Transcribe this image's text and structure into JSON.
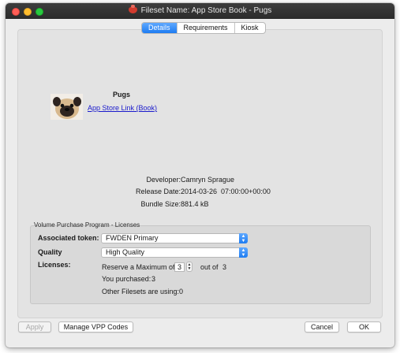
{
  "window": {
    "title": "Fileset Name: App Store Book - Pugs"
  },
  "tabs": [
    {
      "label": "Details",
      "active": true
    },
    {
      "label": "Requirements",
      "active": false
    },
    {
      "label": "Kiosk",
      "active": false
    }
  ],
  "app": {
    "name": "Pugs",
    "link_text": "App Store Link (Book)"
  },
  "info": {
    "developer_label": "Developer:",
    "developer_value": "Camryn Sprague",
    "release_label": "Release Date:",
    "release_value": "2014-03-26  07:00:00+00:00",
    "size_label": "Bundle Size:",
    "size_value": "881.4 kB"
  },
  "vpp": {
    "section_title": "Volume Purchase Program - Licenses",
    "token_label": "Associated token:",
    "token_value": "FWDEN Primary",
    "quality_label": "Quality",
    "quality_value": "High Quality",
    "licenses_label": "Licenses:",
    "reserve_prefix": "Reserve a Maximum of",
    "reserve_value": "3",
    "reserve_suffix": "out of",
    "reserve_total": "3",
    "purchased_text": "You purchased:",
    "purchased_value": "3",
    "other_text": "Other Filesets are using:",
    "other_value": "0"
  },
  "buttons": {
    "apply": "Apply",
    "manage_vpp": "Manage VPP Codes",
    "cancel": "Cancel",
    "ok": "OK"
  },
  "colors": {
    "accent": "#1e7cf2",
    "link": "#1a1acc"
  }
}
